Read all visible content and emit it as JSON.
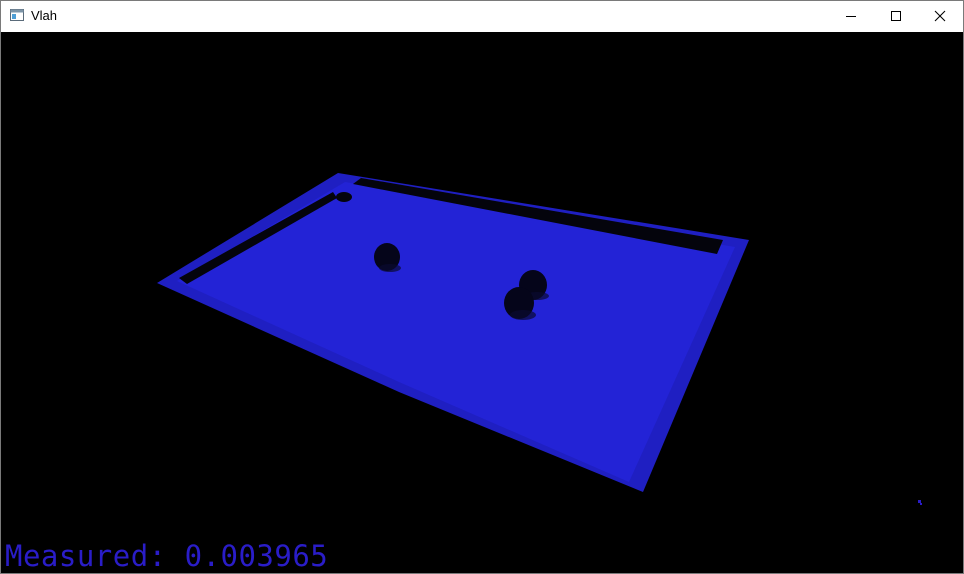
{
  "window": {
    "title": "Vlah",
    "controls": {
      "minimize_icon": "minimize-icon",
      "maximize_icon": "maximize-icon",
      "close_icon": "close-icon"
    }
  },
  "scene": {
    "background_color": "#000000",
    "table_color": "#2626d9",
    "rail_color": "#1f1fc4",
    "ball_color": "#05051a",
    "ball_count": 3
  },
  "overlay": {
    "measured_text": "Measured: 0.003965",
    "text_color": "#2a1dc8"
  }
}
